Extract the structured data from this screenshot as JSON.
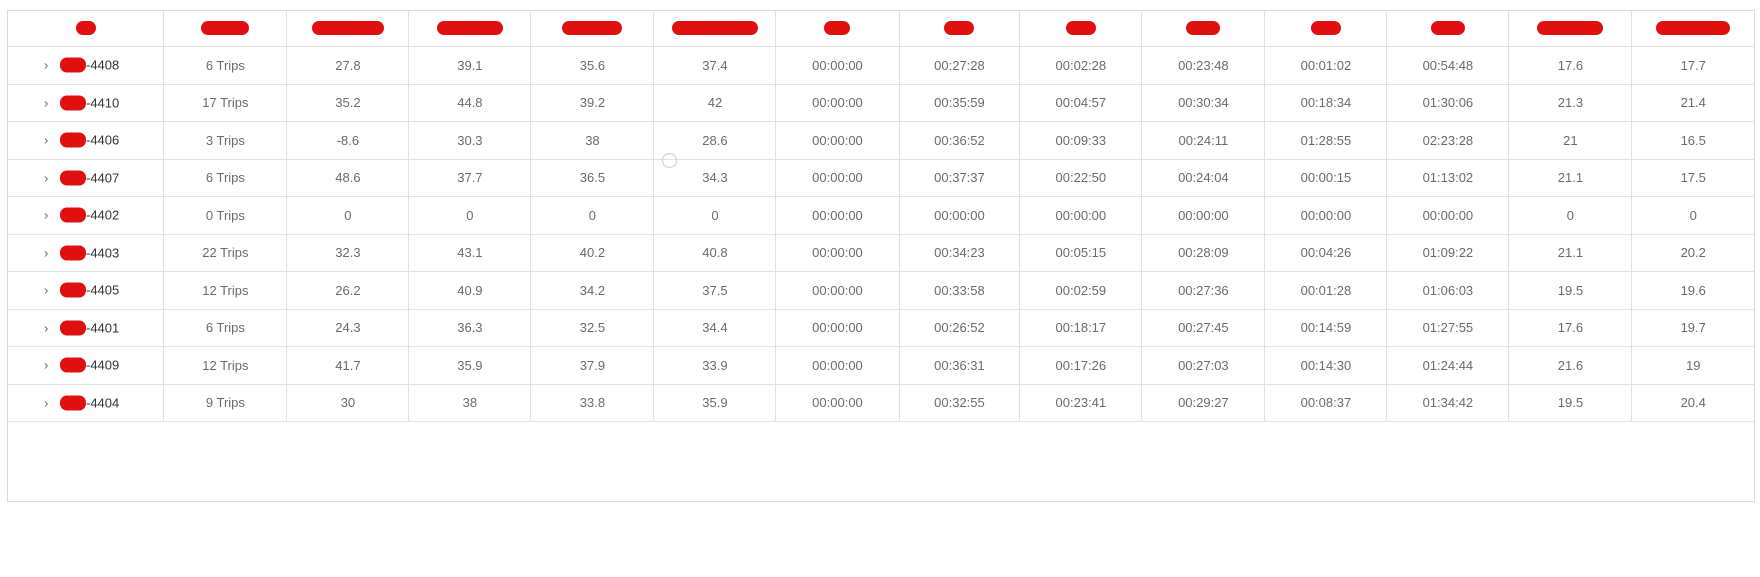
{
  "table": {
    "rows": [
      {
        "vehicle_suffix": "-4408",
        "trips": "6 Trips",
        "c1": "27.8",
        "c2": "39.1",
        "c3": "35.6",
        "c4": "37.4",
        "t1": "00:00:00",
        "t2": "00:27:28",
        "t3": "00:02:28",
        "t4": "00:23:48",
        "t5": "00:01:02",
        "t6": "00:54:48",
        "c5": "17.6",
        "c6": "17.7"
      },
      {
        "vehicle_suffix": "-4410",
        "trips": "17 Trips",
        "c1": "35.2",
        "c2": "44.8",
        "c3": "39.2",
        "c4": "42",
        "t1": "00:00:00",
        "t2": "00:35:59",
        "t3": "00:04:57",
        "t4": "00:30:34",
        "t5": "00:18:34",
        "t6": "01:30:06",
        "c5": "21.3",
        "c6": "21.4"
      },
      {
        "vehicle_suffix": "-4406",
        "trips": "3 Trips",
        "c1": "-8.6",
        "c2": "30.3",
        "c3": "38",
        "c4": "28.6",
        "t1": "00:00:00",
        "t2": "00:36:52",
        "t3": "00:09:33",
        "t4": "00:24:11",
        "t5": "01:28:55",
        "t6": "02:23:28",
        "c5": "21",
        "c6": "16.5"
      },
      {
        "vehicle_suffix": "-4407",
        "trips": "6 Trips",
        "c1": "48.6",
        "c2": "37.7",
        "c3": "36.5",
        "c4": "34.3",
        "t1": "00:00:00",
        "t2": "00:37:37",
        "t3": "00:22:50",
        "t4": "00:24:04",
        "t5": "00:00:15",
        "t6": "01:13:02",
        "c5": "21.1",
        "c6": "17.5"
      },
      {
        "vehicle_suffix": "-4402",
        "trips": "0 Trips",
        "c1": "0",
        "c2": "0",
        "c3": "0",
        "c4": "0",
        "t1": "00:00:00",
        "t2": "00:00:00",
        "t3": "00:00:00",
        "t4": "00:00:00",
        "t5": "00:00:00",
        "t6": "00:00:00",
        "c5": "0",
        "c6": "0"
      },
      {
        "vehicle_suffix": "-4403",
        "trips": "22 Trips",
        "c1": "32.3",
        "c2": "43.1",
        "c3": "40.2",
        "c4": "40.8",
        "t1": "00:00:00",
        "t2": "00:34:23",
        "t3": "00:05:15",
        "t4": "00:28:09",
        "t5": "00:04:26",
        "t6": "01:09:22",
        "c5": "21.1",
        "c6": "20.2"
      },
      {
        "vehicle_suffix": "-4405",
        "trips": "12 Trips",
        "c1": "26.2",
        "c2": "40.9",
        "c3": "34.2",
        "c4": "37.5",
        "t1": "00:00:00",
        "t2": "00:33:58",
        "t3": "00:02:59",
        "t4": "00:27:36",
        "t5": "00:01:28",
        "t6": "01:06:03",
        "c5": "19.5",
        "c6": "19.6"
      },
      {
        "vehicle_suffix": "-4401",
        "trips": "6 Trips",
        "c1": "24.3",
        "c2": "36.3",
        "c3": "32.5",
        "c4": "34.4",
        "t1": "00:00:00",
        "t2": "00:26:52",
        "t3": "00:18:17",
        "t4": "00:27:45",
        "t5": "00:14:59",
        "t6": "01:27:55",
        "c5": "17.6",
        "c6": "19.7"
      },
      {
        "vehicle_suffix": "-4409",
        "trips": "12 Trips",
        "c1": "41.7",
        "c2": "35.9",
        "c3": "37.9",
        "c4": "33.9",
        "t1": "00:00:00",
        "t2": "00:36:31",
        "t3": "00:17:26",
        "t4": "00:27:03",
        "t5": "00:14:30",
        "t6": "01:24:44",
        "c5": "21.6",
        "c6": "19"
      },
      {
        "vehicle_suffix": "-4404",
        "trips": "9 Trips",
        "c1": "30",
        "c2": "38",
        "c3": "33.8",
        "c4": "35.9",
        "t1": "00:00:00",
        "t2": "00:32:55",
        "t3": "00:23:41",
        "t4": "00:29:27",
        "t5": "00:08:37",
        "t6": "01:34:42",
        "c5": "19.5",
        "c6": "20.4"
      }
    ],
    "chevron_icon": "chevron-right-icon",
    "redaction_color": "#e01010"
  }
}
